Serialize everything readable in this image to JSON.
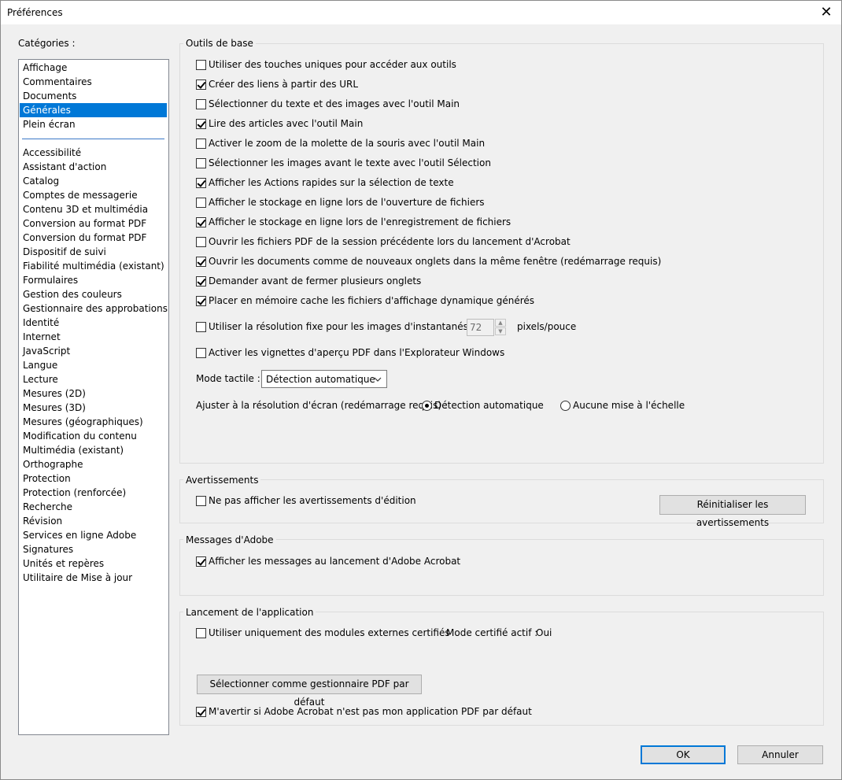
{
  "window": {
    "title": "Préférences",
    "close_glyph": "✕"
  },
  "categories": {
    "label": "Catégories :",
    "top": [
      "Affichage",
      "Commentaires",
      "Documents",
      "Générales",
      "Plein écran"
    ],
    "selected": "Générales",
    "rest": [
      "Accessibilité",
      "Assistant d'action",
      "Catalog",
      "Comptes de messagerie",
      "Contenu 3D et multimédia",
      "Conversion au format PDF",
      "Conversion du format PDF",
      "Dispositif de suivi",
      "Fiabilité multimédia (existant)",
      "Formulaires",
      "Gestion des couleurs",
      "Gestionnaire des approbations",
      "Identité",
      "Internet",
      "JavaScript",
      "Langue",
      "Lecture",
      "Mesures (2D)",
      "Mesures (3D)",
      "Mesures (géographiques)",
      "Modification du contenu",
      "Multimédia (existant)",
      "Orthographe",
      "Protection",
      "Protection (renforcée)",
      "Recherche",
      "Révision",
      "Services en ligne Adobe",
      "Signatures",
      "Unités et repères",
      "Utilitaire de Mise à jour"
    ]
  },
  "outils": {
    "title": "Outils de base",
    "options": [
      {
        "label": "Utiliser des touches uniques pour accéder aux outils",
        "checked": false
      },
      {
        "label": "Créer des liens à partir des URL",
        "checked": true
      },
      {
        "label": "Sélectionner du texte et des images avec l'outil Main",
        "checked": false
      },
      {
        "label": "Lire des articles avec l'outil Main",
        "checked": true
      },
      {
        "label": "Activer le zoom de la molette de la souris avec l'outil Main",
        "checked": false
      },
      {
        "label": "Sélectionner les images avant le texte avec l'outil Sélection",
        "checked": false
      },
      {
        "label": "Afficher les Actions rapides sur la sélection de texte",
        "checked": true
      },
      {
        "label": "Afficher le stockage en ligne lors de l'ouverture de fichiers",
        "checked": false
      },
      {
        "label": "Afficher le stockage en ligne lors de l'enregistrement de fichiers",
        "checked": true
      },
      {
        "label": "Ouvrir les fichiers PDF de la session précédente lors du lancement d'Acrobat",
        "checked": false
      },
      {
        "label": "Ouvrir les documents comme de nouveaux onglets dans la même fenêtre (redémarrage requis)",
        "checked": true
      },
      {
        "label": "Demander avant de fermer plusieurs onglets",
        "checked": true
      },
      {
        "label": "Placer en mémoire cache les fichiers d'affichage dynamique générés",
        "checked": true
      }
    ],
    "resolution": {
      "label": "Utiliser la résolution fixe pour les images d'instantanés :",
      "checked": false,
      "value": "72",
      "unit": "pixels/pouce"
    },
    "vignettes": {
      "label": "Activer les vignettes d'aperçu PDF dans l'Explorateur Windows",
      "checked": false
    },
    "mode_tactile": {
      "label": "Mode tactile :",
      "value": "Détection automatique"
    },
    "ajuster": {
      "label": "Ajuster à la résolution d'écran (redémarrage requis) :",
      "opt1": "Détection automatique",
      "opt2": "Aucune mise à l'échelle",
      "selected": "opt1"
    }
  },
  "avertissements": {
    "title": "Avertissements",
    "option": {
      "label": "Ne pas afficher les avertissements d'édition",
      "checked": false
    },
    "reset_button": "Réinitialiser les avertissements"
  },
  "messages": {
    "title": "Messages d'Adobe",
    "option": {
      "label": "Afficher les messages au lancement d'Adobe Acrobat",
      "checked": true
    }
  },
  "lancement": {
    "title": "Lancement de l'application",
    "option": {
      "label": "Utiliser uniquement des modules externes certifiés",
      "checked": false
    },
    "mode_label": "Mode certifié actif :",
    "mode_value": "Oui",
    "default_button": "Sélectionner comme gestionnaire PDF par défaut",
    "warn": {
      "label": "M'avertir si Adobe Acrobat n'est pas mon application PDF par défaut",
      "checked": true
    }
  },
  "footer": {
    "ok": "OK",
    "cancel": "Annuler"
  }
}
